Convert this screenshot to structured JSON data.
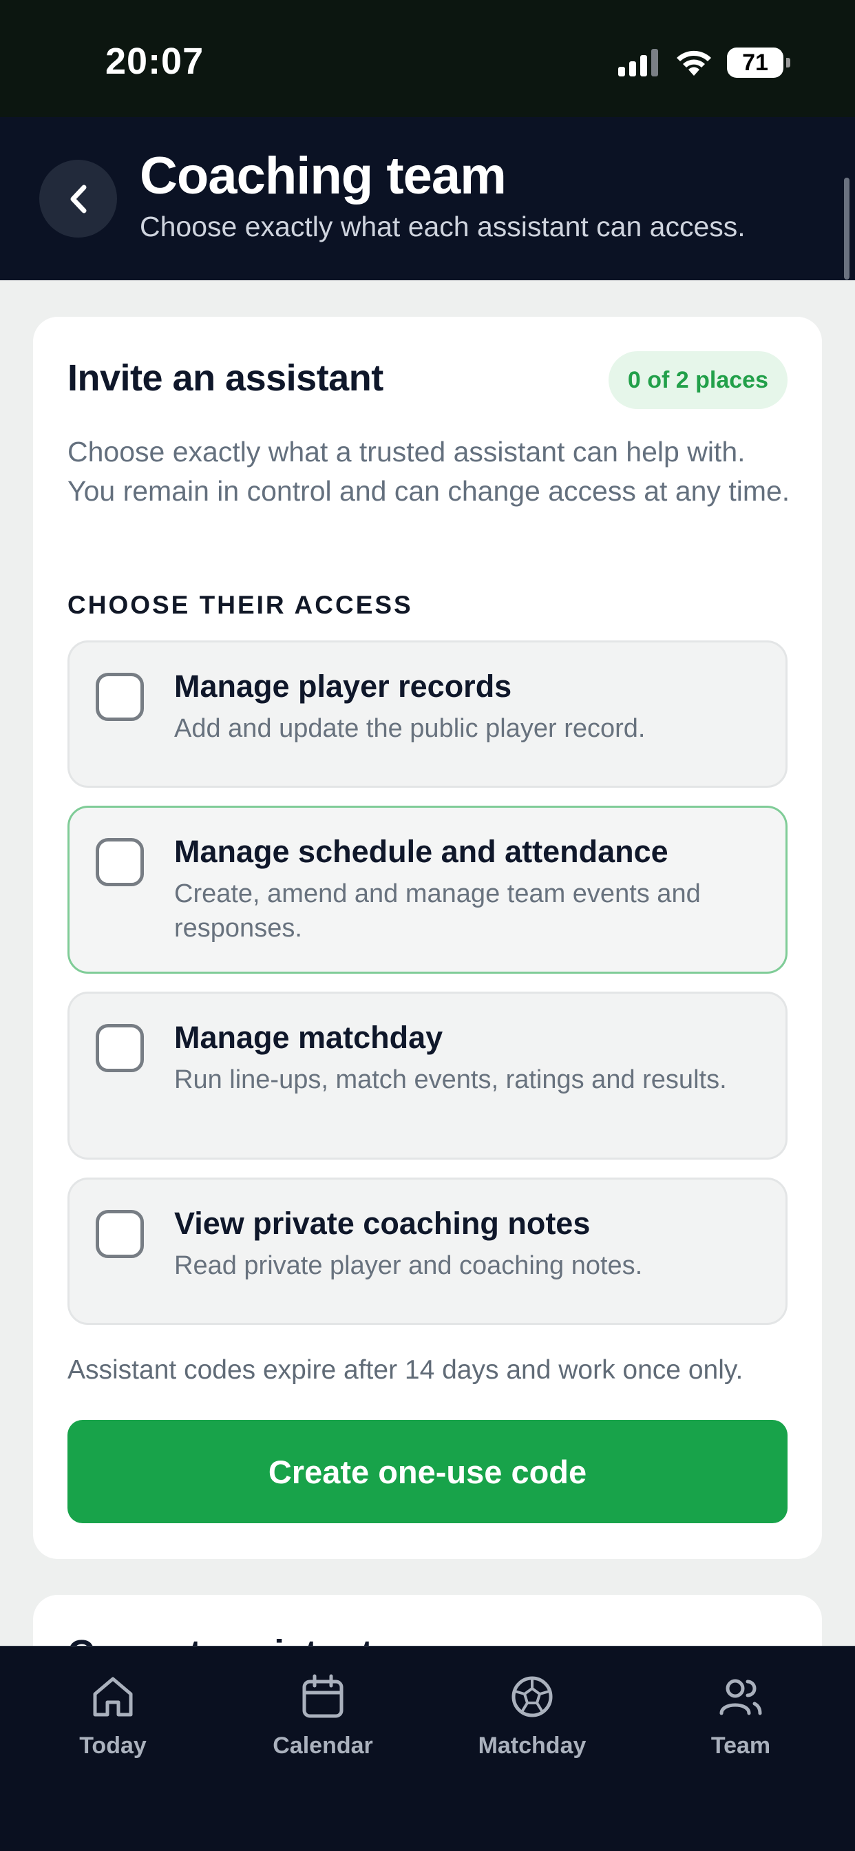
{
  "status": {
    "time": "20:07",
    "battery": "71"
  },
  "header": {
    "title": "Coaching team",
    "subtitle": "Choose exactly what each assistant can access."
  },
  "invite": {
    "title": "Invite an assistant",
    "places_badge": "0 of 2 places",
    "description": "Choose exactly what a trusted assistant can help with. You remain in control and can change access at any time.",
    "section_label": "CHOOSE THEIR ACCESS",
    "options": [
      {
        "title": "Manage player records",
        "description": "Add and update the public player record.",
        "checked": false
      },
      {
        "title": "Manage schedule and attendance",
        "description": "Create, amend and manage team events and responses.",
        "checked": false,
        "focused": true
      },
      {
        "title": "Manage matchday",
        "description": "Run line-ups, match events, ratings and results.",
        "checked": false
      },
      {
        "title": "View private coaching notes",
        "description": "Read private player and coaching notes.",
        "checked": false
      }
    ],
    "expire_note": "Assistant codes expire after 14 days and work once only.",
    "cta_label": "Create one-use code"
  },
  "current": {
    "title": "Current assistants"
  },
  "tabs": [
    {
      "label": "Today",
      "icon": "home-icon"
    },
    {
      "label": "Calendar",
      "icon": "calendar-icon"
    },
    {
      "label": "Matchday",
      "icon": "football-icon"
    },
    {
      "label": "Team",
      "icon": "team-icon"
    }
  ],
  "colors": {
    "accent": "#18a34a",
    "header_bg": "#0b1224",
    "tabbar_bg": "#0a1020"
  }
}
